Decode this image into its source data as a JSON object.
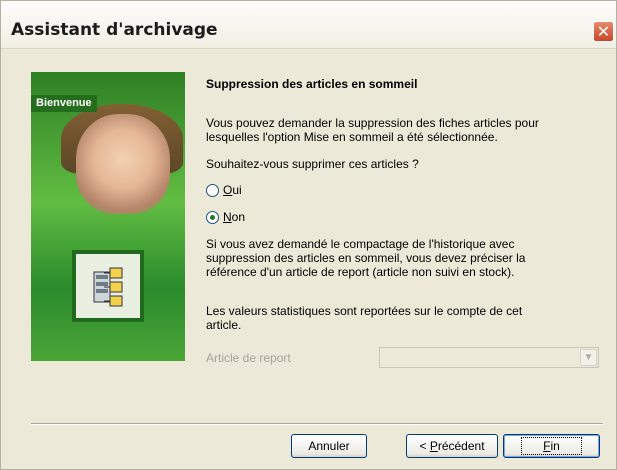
{
  "window": {
    "title": "Assistant d'archivage",
    "close_glyph": "✕"
  },
  "sidebar": {
    "welcome": "Bienvenue",
    "icon": "archive-server-icon"
  },
  "content": {
    "heading": "Suppression des articles en sommeil",
    "para1_line1": "Vous pouvez demander la suppression des fiches articles pour",
    "para1_line2": "lesquelles l'option Mise en sommeil a été sélectionnée.",
    "question": "Souhaitez-vous supprimer ces articles ?",
    "radio_oui": {
      "underline": "O",
      "rest": "ui",
      "checked": false
    },
    "radio_non": {
      "underline": "N",
      "rest": "on",
      "checked": true
    },
    "para2_line1": "Si vous avez demandé le compactage de l'historique avec",
    "para2_line2": "suppression des articles en sommeil, vous devez préciser la",
    "para2_line3": "référence d'un article de report (article non suivi en stock).",
    "para3_line1": "Les valeurs statistiques sont reportées sur le compte de cet",
    "para3_line2": "article.",
    "report_label": "Article de report",
    "report_value": ""
  },
  "buttons": {
    "cancel": "Annuler",
    "prev_prefix": "< ",
    "prev_underline": "P",
    "prev_rest": "récédent",
    "finish_underline": "F",
    "finish_rest": "in"
  }
}
